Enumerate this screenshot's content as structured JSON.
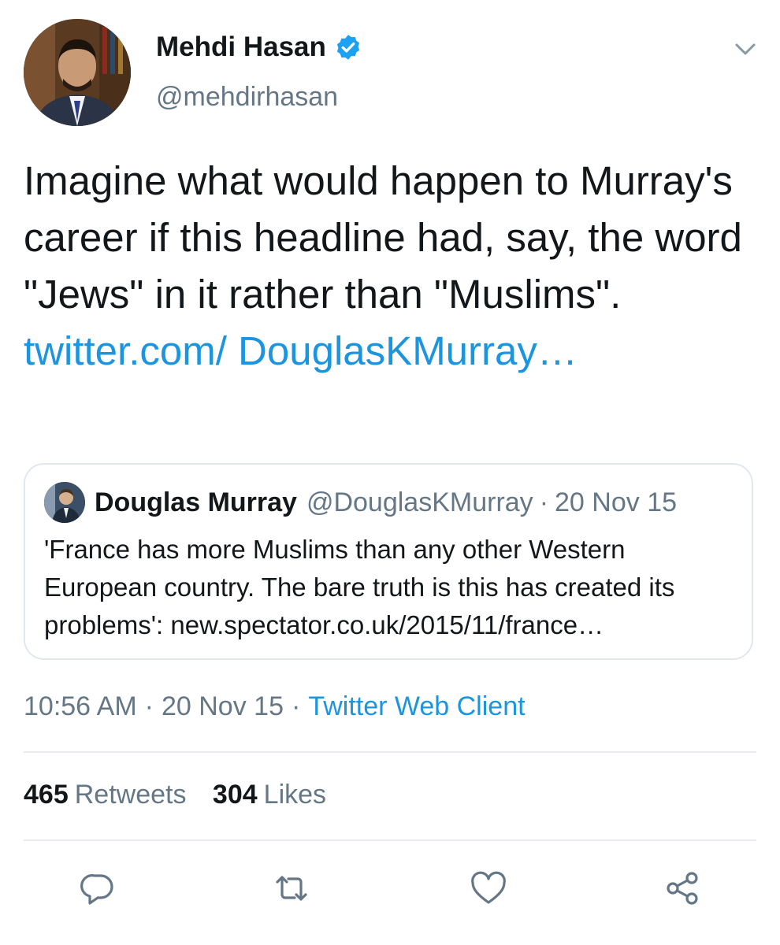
{
  "author": {
    "name": "Mehdi Hasan",
    "handle": "@mehdirhasan",
    "verified": true
  },
  "tweet": {
    "text": "Imagine what would happen to Murray's career if this headline had, say, the word \"Jews\" in it rather than \"Muslims\". ",
    "link_text": "twitter.com/ DouglasKMurray…"
  },
  "quoted": {
    "name": "Douglas Murray",
    "handle": "@DouglasKMurray",
    "separator": "·",
    "date": "20 Nov 15",
    "text": "'France has more Muslims than any other Western European country. The bare truth is this has created its problems': new.spectator.co.uk/2015/11/france…"
  },
  "meta": {
    "time": "10:56 AM",
    "separator": "·",
    "date": "20 Nov 15",
    "source": "Twitter Web Client"
  },
  "stats": {
    "retweets_count": "465",
    "retweets_label": "Retweets",
    "likes_count": "304",
    "likes_label": "Likes"
  },
  "actions": {
    "reply_icon": "reply-icon",
    "retweet_icon": "retweet-icon",
    "like_icon": "heart-icon",
    "share_icon": "share-icon"
  },
  "colors": {
    "link": "#1b95e0",
    "secondary_text": "#657786",
    "primary_text": "#14171a",
    "border": "#e1e8ed",
    "verified": "#1da1f2"
  }
}
